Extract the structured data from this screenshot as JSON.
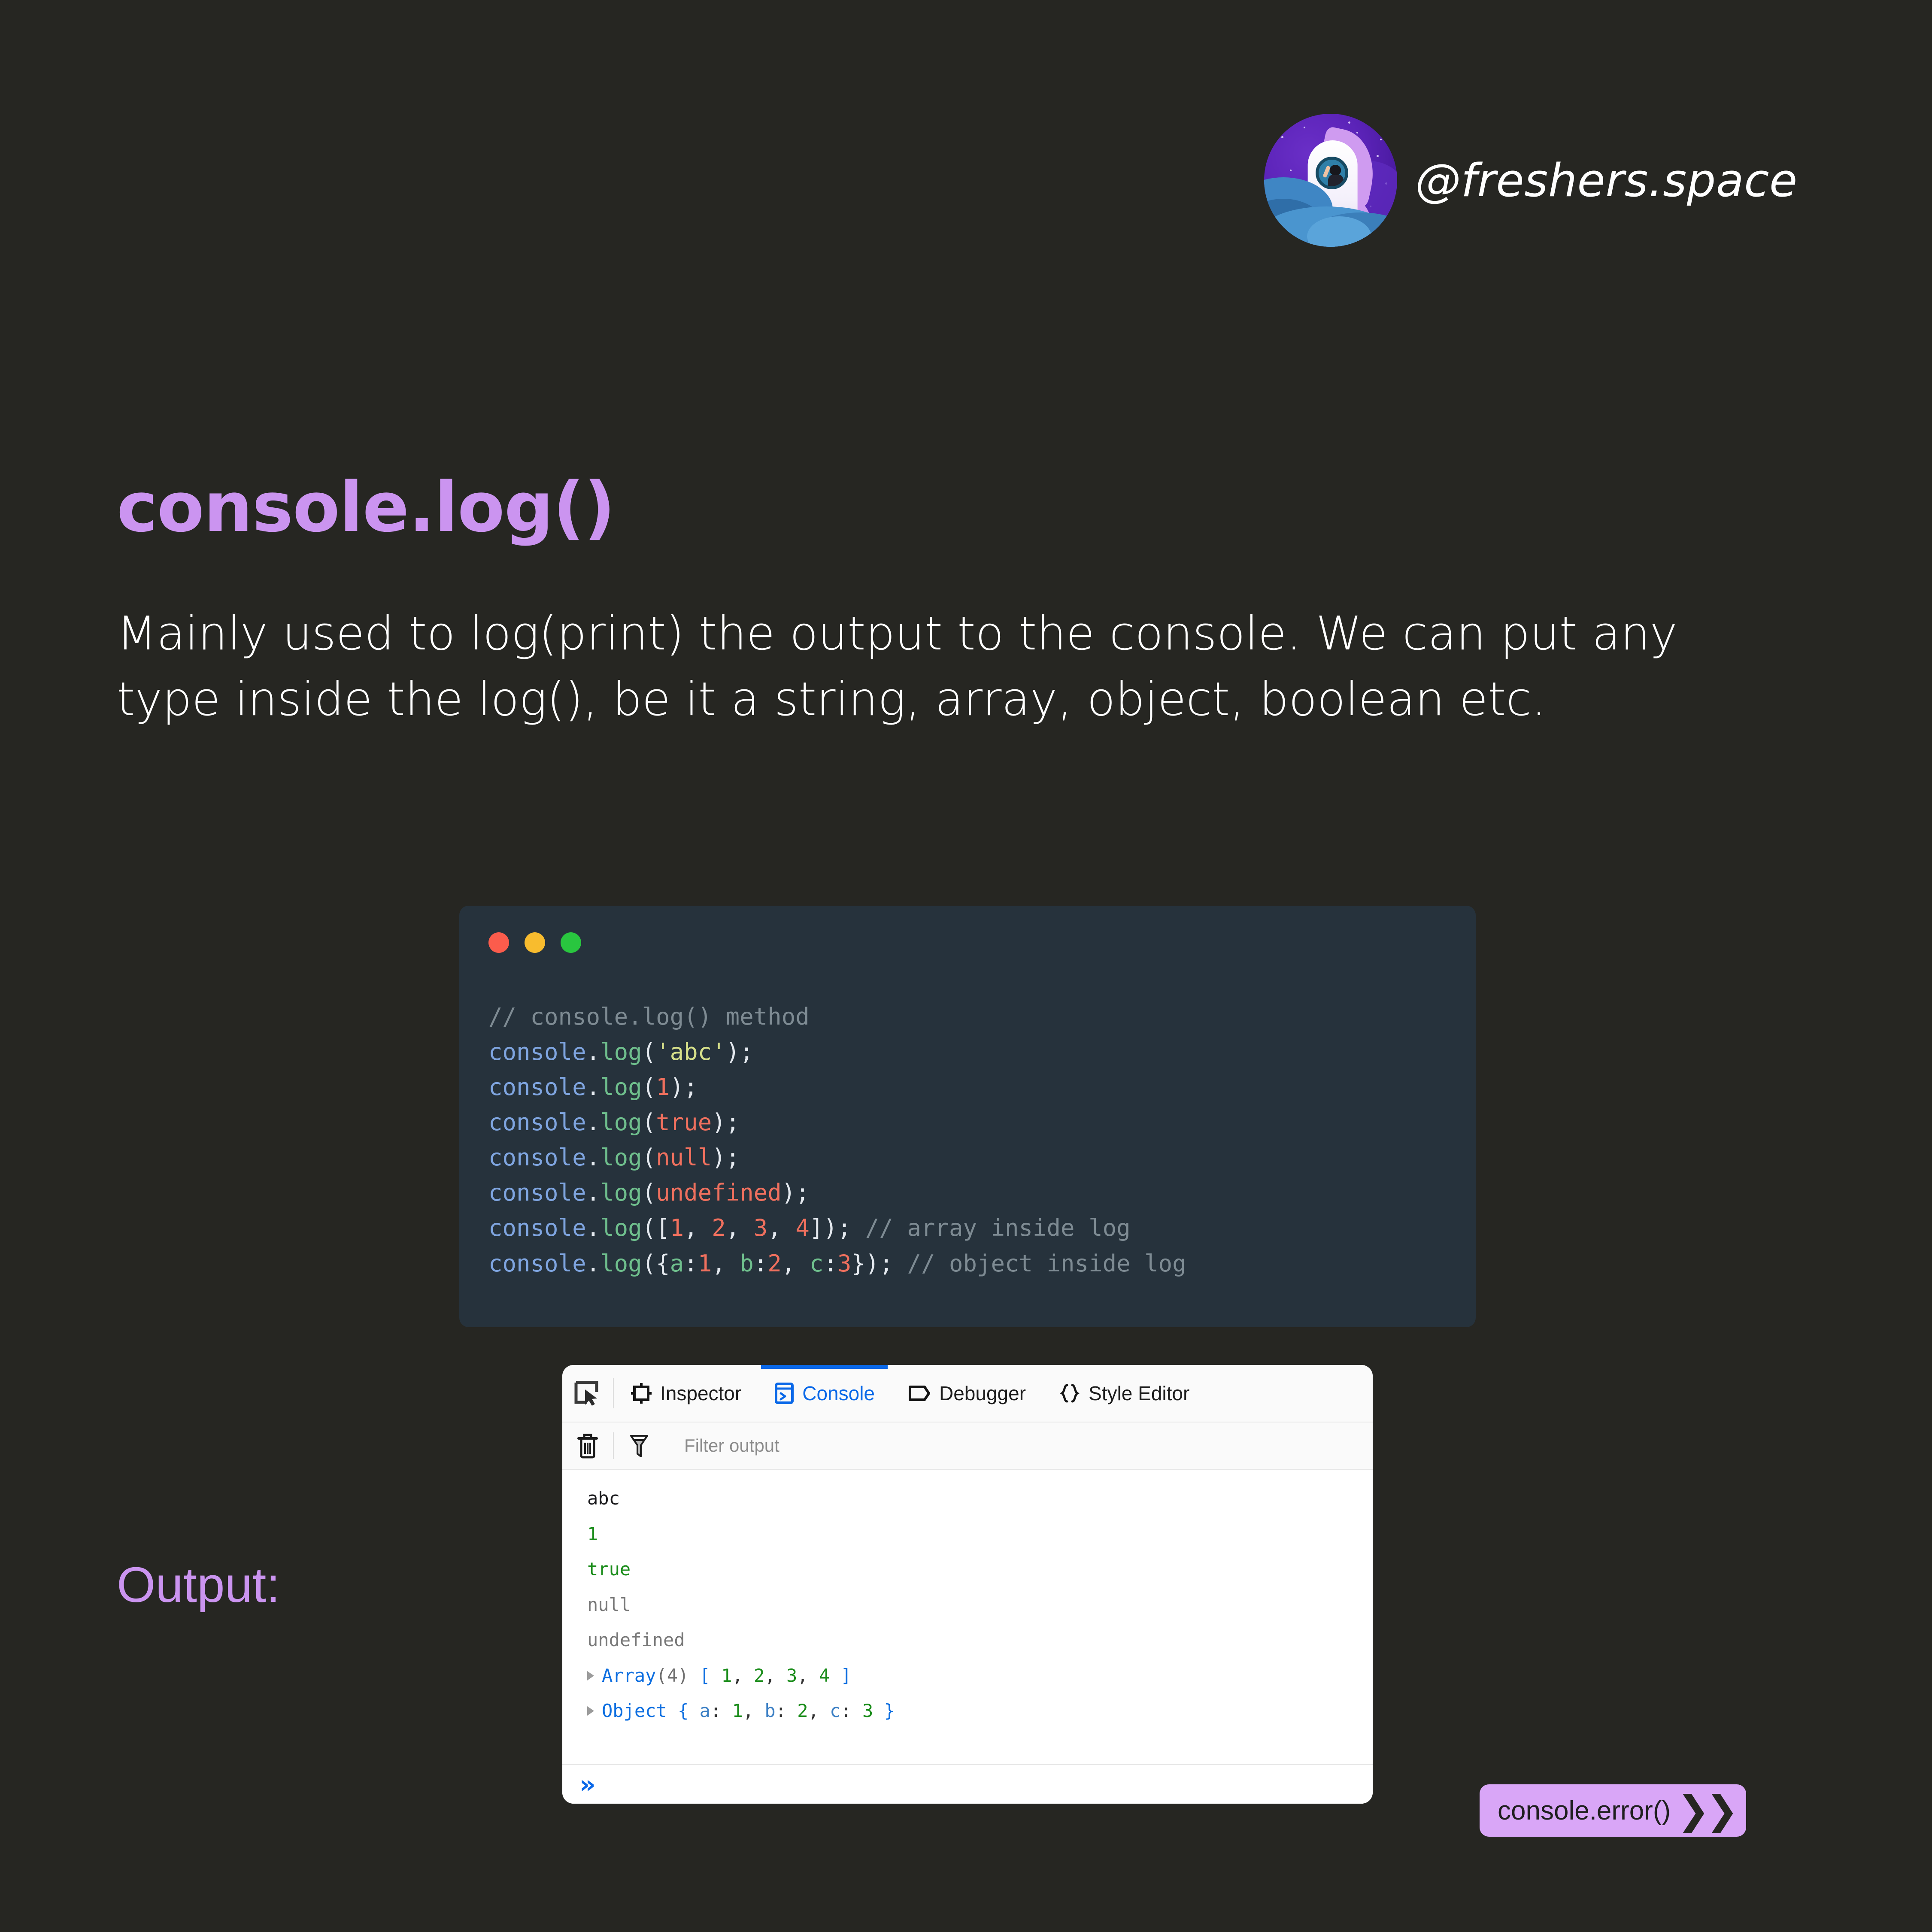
{
  "brand": {
    "handle": "@freshers.space",
    "avatar_icon": "rocket-avatar-icon"
  },
  "title": "console.log()",
  "lead": "Mainly used to log(print) the output to the console. We can put any type inside the log(), be it a string, array, object, boolean etc.",
  "colors": {
    "page_background": "#262622",
    "accent_purple": "#cb94f0",
    "cta_background": "#d9a6f7",
    "code_background": "#26323c",
    "devtools_accent_blue": "#0a68e8"
  },
  "code_card": {
    "window_dots": [
      {
        "name": "close-dot",
        "color": "#fb5c4c"
      },
      {
        "name": "minimize-dot",
        "color": "#f8bc2e"
      },
      {
        "name": "maximize-dot",
        "color": "#29c63f"
      }
    ],
    "lines": [
      {
        "comment": "// console.log() method"
      },
      {
        "obj": "console",
        "dot": ".",
        "fn": "log",
        "open": "(",
        "str": "'abc'",
        "close": ");"
      },
      {
        "obj": "console",
        "dot": ".",
        "fn": "log",
        "open": "(",
        "num": "1",
        "close": ");"
      },
      {
        "obj": "console",
        "dot": ".",
        "fn": "log",
        "open": "(",
        "kw": "true",
        "close": ");"
      },
      {
        "obj": "console",
        "dot": ".",
        "fn": "log",
        "open": "(",
        "kw": "null",
        "close": ");"
      },
      {
        "obj": "console",
        "dot": ".",
        "fn": "log",
        "open": "(",
        "kw": "undefined",
        "close": ");"
      },
      {
        "obj": "console",
        "dot": ".",
        "fn": "log",
        "array_open": "([",
        "array_nums": [
          "1",
          "2",
          "3",
          "4"
        ],
        "array_close": "]);",
        "trailing_comment": "// array inside log"
      },
      {
        "obj": "console",
        "dot": ".",
        "fn": "log",
        "object_open": "({",
        "object_pairs": [
          [
            "a",
            "1"
          ],
          [
            "b",
            "2"
          ],
          [
            "c",
            "3"
          ]
        ],
        "object_close": "});",
        "trailing_comment": "// object inside log"
      }
    ]
  },
  "devtools": {
    "picker_icon": "element-picker-icon",
    "tabs": [
      {
        "label": "Inspector",
        "icon": "inspector-box-icon",
        "active": false
      },
      {
        "label": "Console",
        "icon": "console-prompt-icon",
        "active": true
      },
      {
        "label": "Debugger",
        "icon": "debugger-pentagon-icon",
        "active": false
      },
      {
        "label": "Style Editor",
        "icon": "style-editor-braces-icon",
        "active": false
      }
    ],
    "toolbar": {
      "clear_icon": "trash-icon",
      "filter_icon": "funnel-icon",
      "filter_placeholder": "Filter output"
    },
    "output": [
      {
        "kind": "string",
        "text": "abc"
      },
      {
        "kind": "number",
        "text": "1"
      },
      {
        "kind": "bool",
        "text": "true"
      },
      {
        "kind": "null",
        "text": "null"
      },
      {
        "kind": "null",
        "text": "undefined"
      },
      {
        "kind": "array",
        "type": "Array",
        "count": "(4)",
        "open": "[",
        "items": [
          "1",
          "2",
          "3",
          "4"
        ],
        "close": "]"
      },
      {
        "kind": "object",
        "type": "Object",
        "open": "{",
        "pairs": [
          [
            "a",
            "1"
          ],
          [
            "b",
            "2"
          ],
          [
            "c",
            "3"
          ]
        ],
        "close": "}"
      }
    ],
    "prompt_symbol": "»"
  },
  "output_label": "Output:",
  "cta": {
    "label": "console.error()",
    "chevrons": "❯❯"
  }
}
